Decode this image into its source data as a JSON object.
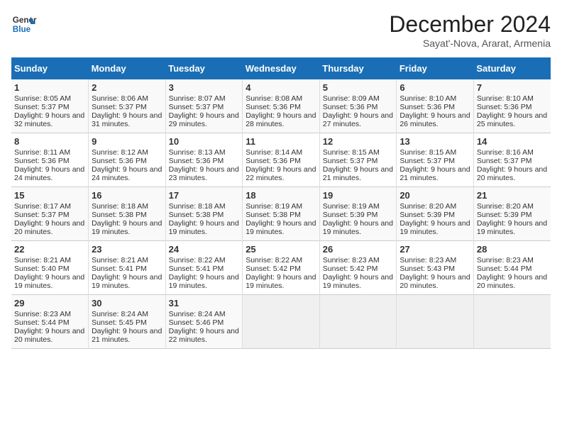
{
  "header": {
    "logo_line1": "General",
    "logo_line2": "Blue",
    "month": "December 2024",
    "location": "Sayat'-Nova, Ararat, Armenia"
  },
  "days_of_week": [
    "Sunday",
    "Monday",
    "Tuesday",
    "Wednesday",
    "Thursday",
    "Friday",
    "Saturday"
  ],
  "weeks": [
    [
      {
        "day": "1",
        "sunrise": "Sunrise: 8:05 AM",
        "sunset": "Sunset: 5:37 PM",
        "daylight": "Daylight: 9 hours and 32 minutes."
      },
      {
        "day": "2",
        "sunrise": "Sunrise: 8:06 AM",
        "sunset": "Sunset: 5:37 PM",
        "daylight": "Daylight: 9 hours and 31 minutes."
      },
      {
        "day": "3",
        "sunrise": "Sunrise: 8:07 AM",
        "sunset": "Sunset: 5:37 PM",
        "daylight": "Daylight: 9 hours and 29 minutes."
      },
      {
        "day": "4",
        "sunrise": "Sunrise: 8:08 AM",
        "sunset": "Sunset: 5:36 PM",
        "daylight": "Daylight: 9 hours and 28 minutes."
      },
      {
        "day": "5",
        "sunrise": "Sunrise: 8:09 AM",
        "sunset": "Sunset: 5:36 PM",
        "daylight": "Daylight: 9 hours and 27 minutes."
      },
      {
        "day": "6",
        "sunrise": "Sunrise: 8:10 AM",
        "sunset": "Sunset: 5:36 PM",
        "daylight": "Daylight: 9 hours and 26 minutes."
      },
      {
        "day": "7",
        "sunrise": "Sunrise: 8:10 AM",
        "sunset": "Sunset: 5:36 PM",
        "daylight": "Daylight: 9 hours and 25 minutes."
      }
    ],
    [
      {
        "day": "8",
        "sunrise": "Sunrise: 8:11 AM",
        "sunset": "Sunset: 5:36 PM",
        "daylight": "Daylight: 9 hours and 24 minutes."
      },
      {
        "day": "9",
        "sunrise": "Sunrise: 8:12 AM",
        "sunset": "Sunset: 5:36 PM",
        "daylight": "Daylight: 9 hours and 24 minutes."
      },
      {
        "day": "10",
        "sunrise": "Sunrise: 8:13 AM",
        "sunset": "Sunset: 5:36 PM",
        "daylight": "Daylight: 9 hours and 23 minutes."
      },
      {
        "day": "11",
        "sunrise": "Sunrise: 8:14 AM",
        "sunset": "Sunset: 5:36 PM",
        "daylight": "Daylight: 9 hours and 22 minutes."
      },
      {
        "day": "12",
        "sunrise": "Sunrise: 8:15 AM",
        "sunset": "Sunset: 5:37 PM",
        "daylight": "Daylight: 9 hours and 21 minutes."
      },
      {
        "day": "13",
        "sunrise": "Sunrise: 8:15 AM",
        "sunset": "Sunset: 5:37 PM",
        "daylight": "Daylight: 9 hours and 21 minutes."
      },
      {
        "day": "14",
        "sunrise": "Sunrise: 8:16 AM",
        "sunset": "Sunset: 5:37 PM",
        "daylight": "Daylight: 9 hours and 20 minutes."
      }
    ],
    [
      {
        "day": "15",
        "sunrise": "Sunrise: 8:17 AM",
        "sunset": "Sunset: 5:37 PM",
        "daylight": "Daylight: 9 hours and 20 minutes."
      },
      {
        "day": "16",
        "sunrise": "Sunrise: 8:18 AM",
        "sunset": "Sunset: 5:38 PM",
        "daylight": "Daylight: 9 hours and 19 minutes."
      },
      {
        "day": "17",
        "sunrise": "Sunrise: 8:18 AM",
        "sunset": "Sunset: 5:38 PM",
        "daylight": "Daylight: 9 hours and 19 minutes."
      },
      {
        "day": "18",
        "sunrise": "Sunrise: 8:19 AM",
        "sunset": "Sunset: 5:38 PM",
        "daylight": "Daylight: 9 hours and 19 minutes."
      },
      {
        "day": "19",
        "sunrise": "Sunrise: 8:19 AM",
        "sunset": "Sunset: 5:39 PM",
        "daylight": "Daylight: 9 hours and 19 minutes."
      },
      {
        "day": "20",
        "sunrise": "Sunrise: 8:20 AM",
        "sunset": "Sunset: 5:39 PM",
        "daylight": "Daylight: 9 hours and 19 minutes."
      },
      {
        "day": "21",
        "sunrise": "Sunrise: 8:20 AM",
        "sunset": "Sunset: 5:39 PM",
        "daylight": "Daylight: 9 hours and 19 minutes."
      }
    ],
    [
      {
        "day": "22",
        "sunrise": "Sunrise: 8:21 AM",
        "sunset": "Sunset: 5:40 PM",
        "daylight": "Daylight: 9 hours and 19 minutes."
      },
      {
        "day": "23",
        "sunrise": "Sunrise: 8:21 AM",
        "sunset": "Sunset: 5:41 PM",
        "daylight": "Daylight: 9 hours and 19 minutes."
      },
      {
        "day": "24",
        "sunrise": "Sunrise: 8:22 AM",
        "sunset": "Sunset: 5:41 PM",
        "daylight": "Daylight: 9 hours and 19 minutes."
      },
      {
        "day": "25",
        "sunrise": "Sunrise: 8:22 AM",
        "sunset": "Sunset: 5:42 PM",
        "daylight": "Daylight: 9 hours and 19 minutes."
      },
      {
        "day": "26",
        "sunrise": "Sunrise: 8:23 AM",
        "sunset": "Sunset: 5:42 PM",
        "daylight": "Daylight: 9 hours and 19 minutes."
      },
      {
        "day": "27",
        "sunrise": "Sunrise: 8:23 AM",
        "sunset": "Sunset: 5:43 PM",
        "daylight": "Daylight: 9 hours and 20 minutes."
      },
      {
        "day": "28",
        "sunrise": "Sunrise: 8:23 AM",
        "sunset": "Sunset: 5:44 PM",
        "daylight": "Daylight: 9 hours and 20 minutes."
      }
    ],
    [
      {
        "day": "29",
        "sunrise": "Sunrise: 8:23 AM",
        "sunset": "Sunset: 5:44 PM",
        "daylight": "Daylight: 9 hours and 20 minutes."
      },
      {
        "day": "30",
        "sunrise": "Sunrise: 8:24 AM",
        "sunset": "Sunset: 5:45 PM",
        "daylight": "Daylight: 9 hours and 21 minutes."
      },
      {
        "day": "31",
        "sunrise": "Sunrise: 8:24 AM",
        "sunset": "Sunset: 5:46 PM",
        "daylight": "Daylight: 9 hours and 22 minutes."
      },
      null,
      null,
      null,
      null
    ]
  ]
}
